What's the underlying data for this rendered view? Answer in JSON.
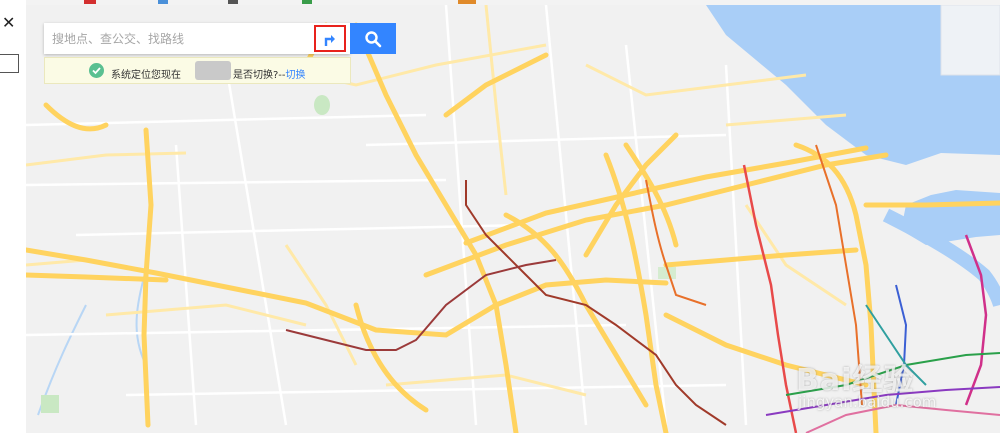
{
  "left_panel": {
    "close_glyph": "✕"
  },
  "search": {
    "placeholder": "搜地点、查公交、找路线"
  },
  "route_button": {
    "icon": "route-arrow-icon"
  },
  "search_button": {
    "icon": "search-icon"
  },
  "location_notice": {
    "text_before": "系统定位您现在",
    "text_after": "是否切换?--",
    "switch_label": "切换"
  },
  "watermark": {
    "logo_text": "Bai经验",
    "url": "jingyan.baidu.com"
  },
  "colors": {
    "map_background": "#f1f1f1",
    "water": "#a9cef7",
    "highway": "#ffd35f",
    "minor_road": "#ffe9a8",
    "search_button": "#3385ff",
    "highlight_border": "#e8221c",
    "notice_bg": "#fbfbe5",
    "check_icon": "#5ac091"
  }
}
